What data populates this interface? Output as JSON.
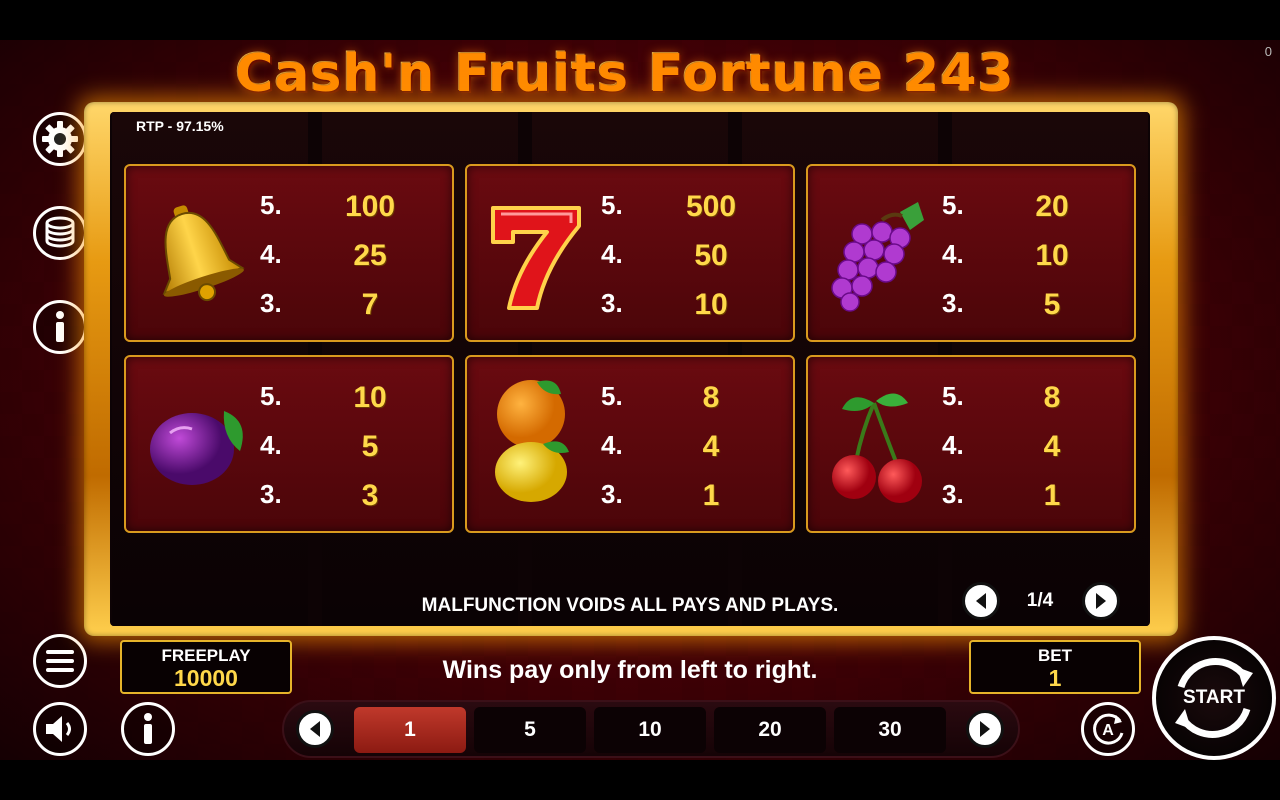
{
  "game": {
    "title": "Cash'n Fruits Fortune 243",
    "rtp": "RTP - 97.15%",
    "corner_counter": "0"
  },
  "paytable": [
    {
      "symbol": "bell-icon",
      "payouts": [
        {
          "count": "5.",
          "value": "100"
        },
        {
          "count": "4.",
          "value": "25"
        },
        {
          "count": "3.",
          "value": "7"
        }
      ]
    },
    {
      "symbol": "seven-icon",
      "payouts": [
        {
          "count": "5.",
          "value": "500"
        },
        {
          "count": "4.",
          "value": "50"
        },
        {
          "count": "3.",
          "value": "10"
        }
      ]
    },
    {
      "symbol": "grapes-icon",
      "payouts": [
        {
          "count": "5.",
          "value": "20"
        },
        {
          "count": "4.",
          "value": "10"
        },
        {
          "count": "3.",
          "value": "5"
        }
      ]
    },
    {
      "symbol": "plum-icon",
      "payouts": [
        {
          "count": "5.",
          "value": "10"
        },
        {
          "count": "4.",
          "value": "5"
        },
        {
          "count": "3.",
          "value": "3"
        }
      ]
    },
    {
      "symbol": "orange-lemon-icon",
      "payouts": [
        {
          "count": "5.",
          "value": "8"
        },
        {
          "count": "4.",
          "value": "4"
        },
        {
          "count": "3.",
          "value": "1"
        }
      ]
    },
    {
      "symbol": "cherries-icon",
      "payouts": [
        {
          "count": "5.",
          "value": "8"
        },
        {
          "count": "4.",
          "value": "4"
        },
        {
          "count": "3.",
          "value": "1"
        }
      ]
    }
  ],
  "notice": "MALFUNCTION VOIDS ALL PAYS AND PLAYS.",
  "pager": {
    "label": "1/4"
  },
  "balance": {
    "label": "FREEPLAY",
    "value": "10000"
  },
  "rule": "Wins pay only from left to right.",
  "bet": {
    "label": "BET",
    "value": "1"
  },
  "bet_options": [
    "1",
    "5",
    "10",
    "20",
    "30"
  ],
  "selected_bet": "1",
  "start_label": "START",
  "colors": {
    "accent_gold": "#ffd84a",
    "frame_orange": "#e79a12",
    "panel_red": "#5a0a0f",
    "selected_red": "#c0392b"
  }
}
